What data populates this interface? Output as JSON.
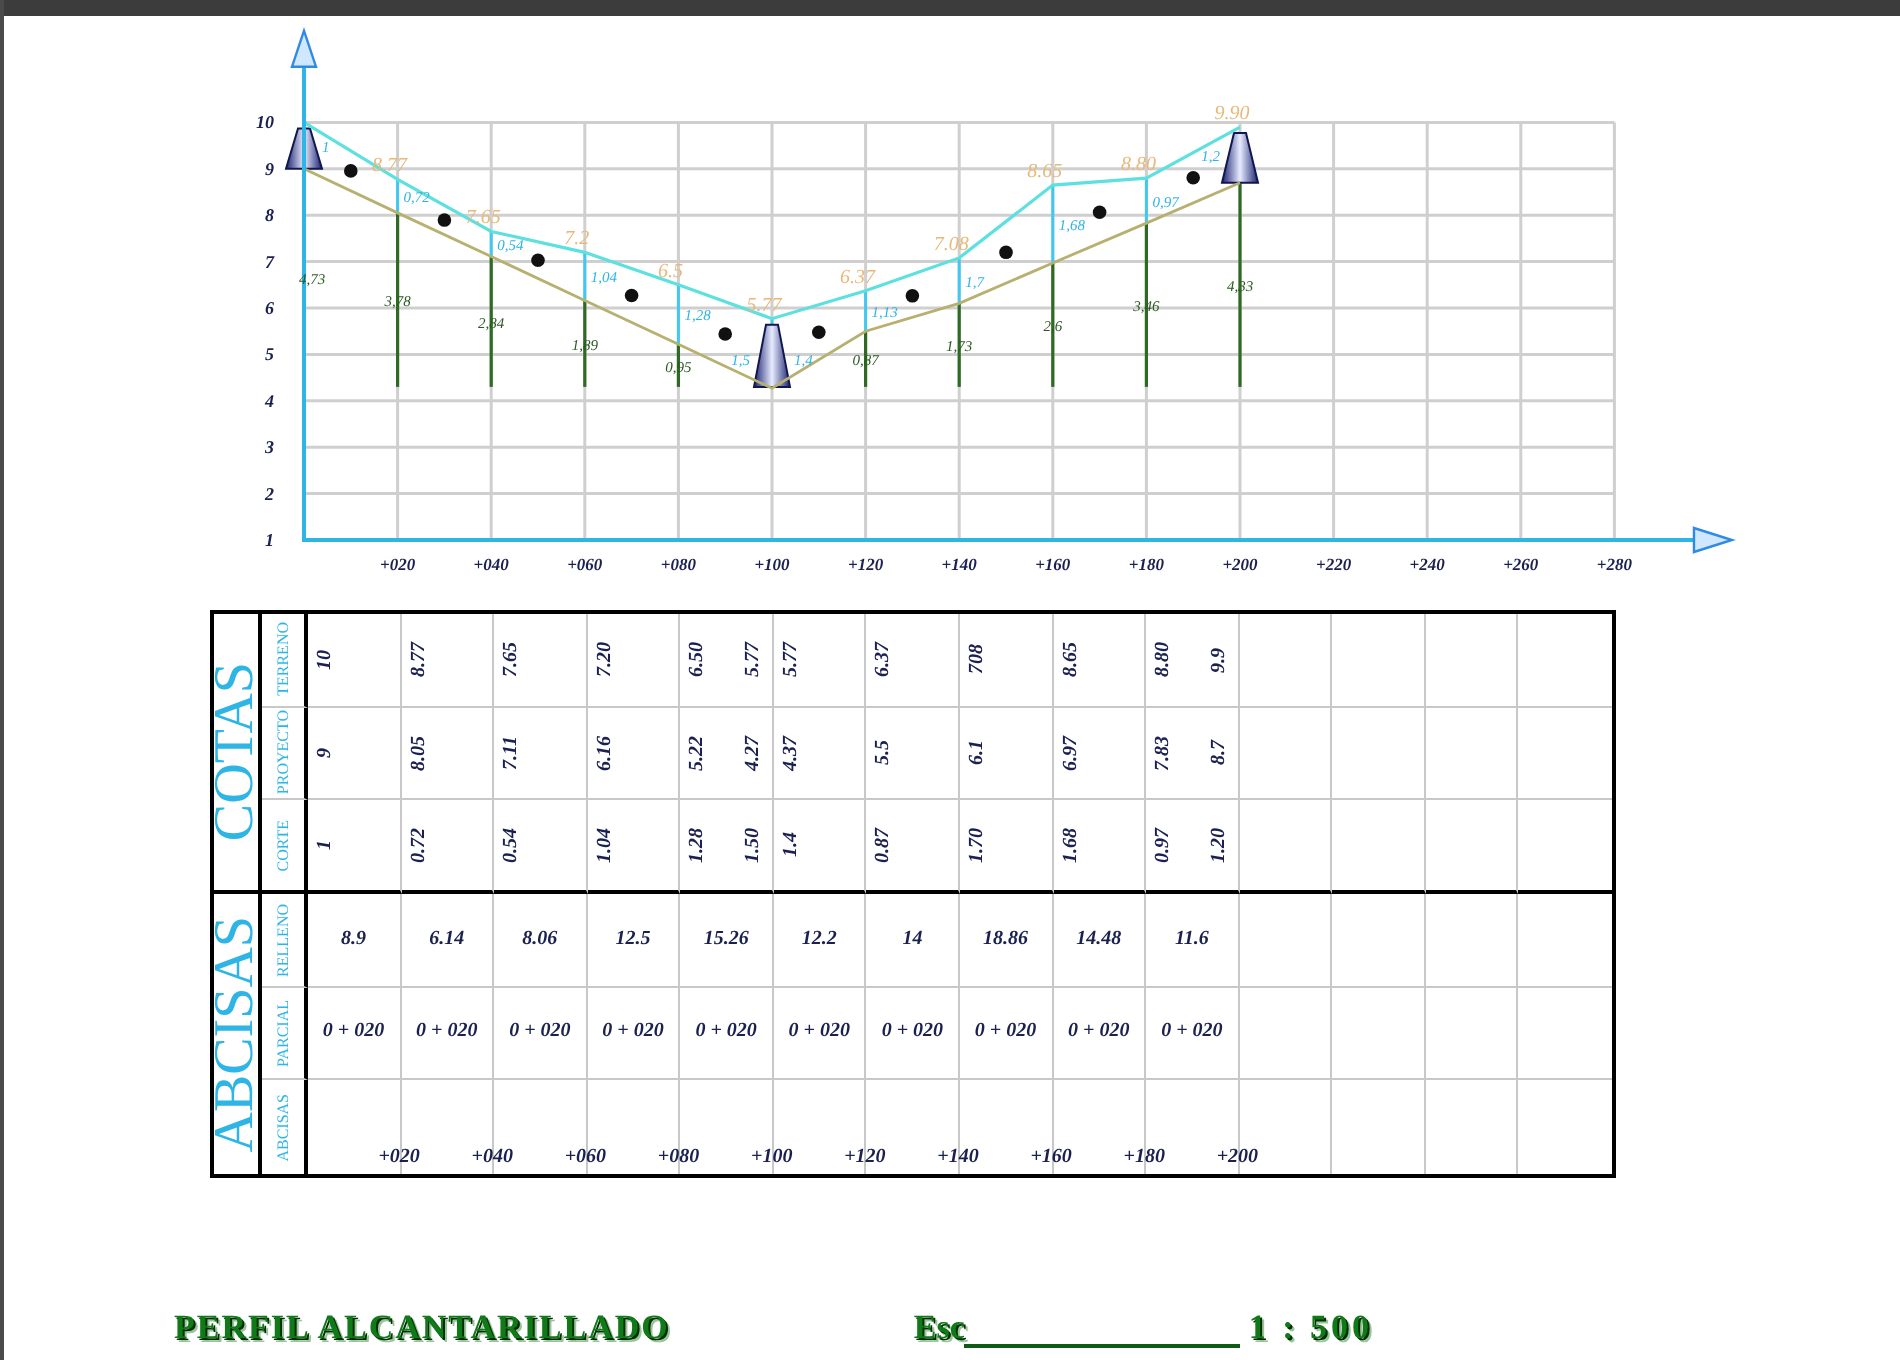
{
  "profile": {
    "chart_data": {
      "type": "line",
      "grid": true,
      "x": [
        0,
        20,
        40,
        60,
        80,
        100,
        120,
        140,
        160,
        180,
        200
      ],
      "series": [
        {
          "color": "#5ee0e0",
          "values": [
            10,
            8.77,
            7.65,
            7.2,
            6.5,
            5.77,
            6.37,
            7.08,
            8.65,
            8.8,
            9.9
          ]
        },
        {
          "color": "#b8b070",
          "values": [
            9,
            8.05,
            7.11,
            6.16,
            5.22,
            4.27,
            5.5,
            6.1,
            6.97,
            7.83,
            8.7
          ]
        }
      ],
      "xlim": [
        0,
        297
      ],
      "ylim": [
        1,
        11.2
      ],
      "xticks": [
        {
          "value": 20,
          "label": "+020"
        },
        {
          "value": 40,
          "label": "+040"
        },
        {
          "value": 60,
          "label": "+060"
        },
        {
          "value": 80,
          "label": "+080"
        },
        {
          "value": 100,
          "label": "+100"
        },
        {
          "value": 120,
          "label": "+120"
        },
        {
          "value": 140,
          "label": "+140"
        },
        {
          "value": 160,
          "label": "+160"
        },
        {
          "value": 180,
          "label": "+180"
        },
        {
          "value": 200,
          "label": "+200"
        },
        {
          "value": 220,
          "label": "+220"
        },
        {
          "value": 240,
          "label": "+240"
        },
        {
          "value": 260,
          "label": "+260"
        },
        {
          "value": 280,
          "label": "+280"
        }
      ],
      "yticks": [
        {
          "value": 1,
          "label": "1"
        },
        {
          "value": 2,
          "label": "2"
        },
        {
          "value": 3,
          "label": "3"
        },
        {
          "value": 4,
          "label": "4"
        },
        {
          "value": 5,
          "label": "5"
        },
        {
          "value": 6,
          "label": "6"
        },
        {
          "value": 7,
          "label": "7"
        },
        {
          "value": 8,
          "label": "8"
        },
        {
          "value": 9,
          "label": "9"
        },
        {
          "value": 10,
          "label": "10"
        }
      ]
    },
    "elevation_labels": [
      "8.77",
      "7.65",
      "7.2",
      "6.5",
      "5.77",
      "6.37",
      "7.08",
      "8.65",
      "8.80",
      "9.90"
    ],
    "cut_labels": [
      [
        "1"
      ],
      [
        "0,72"
      ],
      [
        "0,54"
      ],
      [
        "1,04"
      ],
      [
        "1,28"
      ],
      [
        "1,5",
        "1,4"
      ],
      [
        "1,13"
      ],
      [
        "1,7"
      ],
      [
        "1,68"
      ],
      [
        "0,97"
      ],
      [
        "1,2"
      ]
    ],
    "depth_labels": [
      "4,73",
      "3,78",
      "2,84",
      "1,89",
      "0,95",
      "0,87",
      "1,73",
      "2,6",
      "3,46",
      "4,33"
    ]
  },
  "table": {
    "groups": [
      {
        "label": "COTAS",
        "rows": [
          {
            "label": "TERRENO",
            "kind": "vertical",
            "cells": [
              [
                "10"
              ],
              [
                "8.77"
              ],
              [
                "7.65"
              ],
              [
                "7.20"
              ],
              [
                "6.50",
                "5.77"
              ],
              [
                "5.77"
              ],
              [
                "6.37"
              ],
              [
                "708"
              ],
              [
                "8.65"
              ],
              [
                "8.80",
                "9.9"
              ]
            ]
          },
          {
            "label": "PROYECTO",
            "kind": "vertical",
            "cells": [
              [
                "9"
              ],
              [
                "8.05"
              ],
              [
                "7.11"
              ],
              [
                "6.16"
              ],
              [
                "5.22",
                "4.27"
              ],
              [
                "4.37"
              ],
              [
                "5.5"
              ],
              [
                "6.1"
              ],
              [
                "6.97"
              ],
              [
                "7.83",
                "8.7"
              ]
            ]
          },
          {
            "label": "CORTE",
            "kind": "vertical",
            "cells": [
              [
                "1"
              ],
              [
                "0.72"
              ],
              [
                "0.54"
              ],
              [
                "1.04"
              ],
              [
                "1.28",
                "1.50"
              ],
              [
                "1.4"
              ],
              [
                "0.87"
              ],
              [
                "1.70"
              ],
              [
                "1.68"
              ],
              [
                "0.97",
                "1.20"
              ]
            ]
          }
        ]
      },
      {
        "label": "ABCISAS",
        "rows": [
          {
            "label": "RELLENO",
            "kind": "centered",
            "cells": [
              "8.9",
              "6.14",
              "8.06",
              "12.5",
              "15.26",
              "12.2",
              "14",
              "18.86",
              "14.48",
              "11.6"
            ]
          },
          {
            "label": "PARCIAL",
            "kind": "centered",
            "cells": [
              "0 + 020",
              "0 + 020",
              "0 + 020",
              "0 + 020",
              "0 + 020",
              "0 + 020",
              "0 + 020",
              "0 + 020",
              "0 + 020",
              "0 + 020"
            ]
          },
          {
            "label": "ABCISAS",
            "kind": "station",
            "cells": [
              "+020",
              "+040",
              "+060",
              "+080",
              "+100",
              "+120",
              "+140",
              "+160",
              "+180",
              "+200"
            ]
          }
        ]
      }
    ]
  },
  "footer": {
    "title": "PERFIL ALCANTARILLADO",
    "scale_label": "Esc",
    "scale": "1 : 500"
  }
}
